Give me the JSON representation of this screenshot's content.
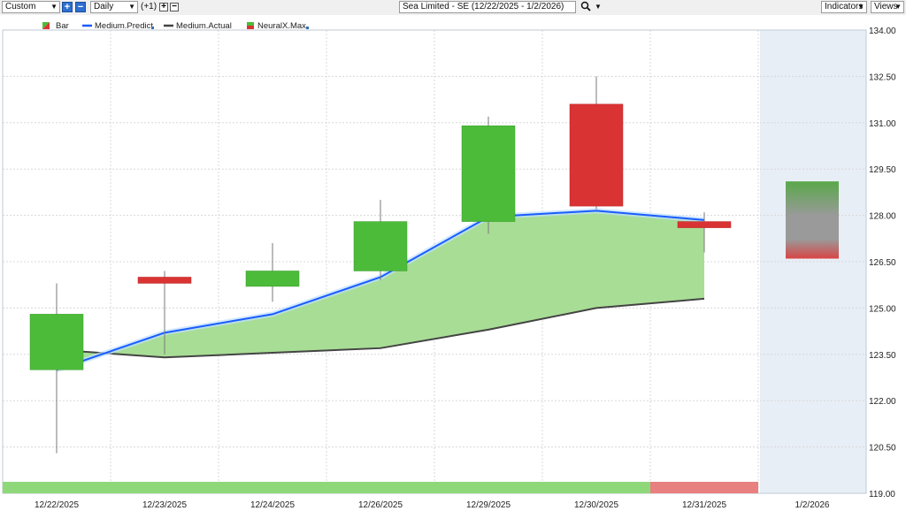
{
  "toolbar": {
    "layout_select": "Custom",
    "interval_select": "Daily",
    "offset_label": "(+1)",
    "plus": "+",
    "minus": "−",
    "symbol_select": "Sea Limited - SE (12/22/2025 - 1/2/2026)",
    "indicators_label": "Indicators",
    "views_label": "Views"
  },
  "colors": {
    "up": "#4cbb3a",
    "down": "#d93333",
    "predict": "#1a5cff",
    "actual": "#444444",
    "band": "#a8dd95",
    "future_bg": "#e8eef6"
  },
  "legend": [
    "Bar",
    "Medium.Predict",
    "Medium.Actual",
    "NeuralX.Max"
  ],
  "chart_data": {
    "type": "candlestick",
    "categories": [
      "12/22/2025",
      "12/23/2025",
      "12/24/2025",
      "12/26/2025",
      "12/29/2025",
      "12/30/2025",
      "12/31/2025",
      "1/2/2026"
    ],
    "ylim": [
      119.0,
      134.0
    ],
    "y_ticks": [
      "119.00",
      "120.50",
      "122.00",
      "123.50",
      "125.00",
      "126.50",
      "128.00",
      "129.50",
      "131.00",
      "132.50",
      "134.00"
    ],
    "candles": [
      {
        "open": 123.0,
        "high": 125.8,
        "low": 120.3,
        "close": 124.8
      },
      {
        "open": 126.0,
        "high": 126.2,
        "low": 123.5,
        "close": 125.8
      },
      {
        "open": 125.7,
        "high": 127.1,
        "low": 125.2,
        "close": 126.2
      },
      {
        "open": 126.2,
        "high": 128.5,
        "low": 125.9,
        "close": 127.8
      },
      {
        "open": 127.8,
        "high": 131.2,
        "low": 127.4,
        "close": 130.9
      },
      {
        "open": 131.6,
        "high": 132.5,
        "low": 128.2,
        "close": 128.3
      },
      {
        "open": 127.8,
        "high": 128.1,
        "low": 126.8,
        "close": 127.6
      }
    ],
    "forecast_bar": {
      "high": 129.1,
      "low": 126.6
    },
    "series": [
      {
        "name": "Medium.Predict",
        "values": [
          123.0,
          124.2,
          124.8,
          126.0,
          127.95,
          128.15,
          127.85
        ]
      },
      {
        "name": "Medium.Actual",
        "values": [
          123.65,
          123.4,
          123.55,
          123.7,
          124.3,
          125.0,
          125.3
        ]
      }
    ],
    "signal_strip": [
      "up",
      "up",
      "up",
      "up",
      "up",
      "up",
      "down"
    ]
  }
}
